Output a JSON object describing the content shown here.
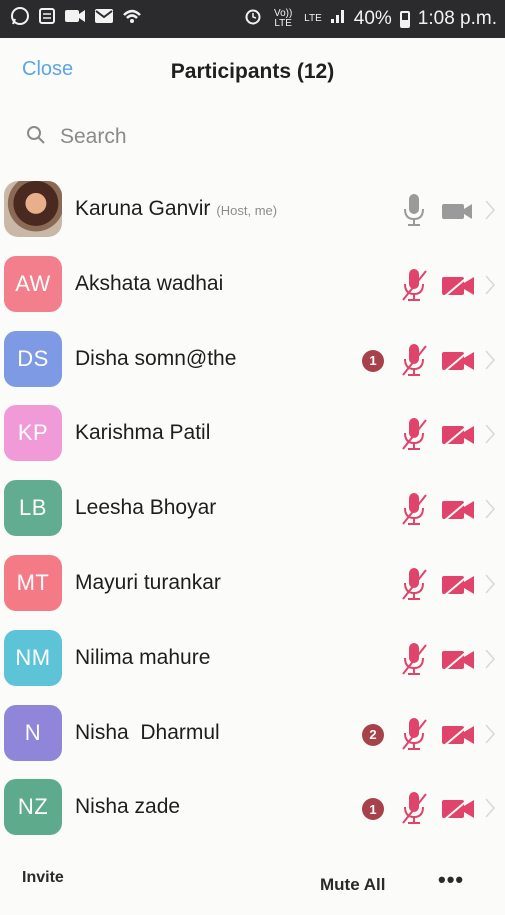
{
  "status_bar": {
    "left_icons": [
      "whatsapp-icon",
      "message-icon",
      "video-icon",
      "email-icon",
      "wifi-sync-icon"
    ],
    "alarm_icon": "alarm-icon",
    "volte_label": "Vo)) LTE",
    "lte_label": "LTE",
    "battery": "40%",
    "time": "1:08 p.m."
  },
  "header": {
    "close_label": "Close",
    "title": "Participants (12)"
  },
  "search": {
    "placeholder": "Search"
  },
  "participants": [
    {
      "initials": "",
      "name": "Karuna Ganvir",
      "tag": "(Host, me)",
      "color": "",
      "photo": true,
      "badge": "",
      "muted": false
    },
    {
      "initials": "AW",
      "name": "Akshata wadhai",
      "tag": "",
      "color": "#f37e8c",
      "photo": false,
      "badge": "",
      "muted": true
    },
    {
      "initials": "DS",
      "name": "Disha somn@the",
      "tag": "",
      "color": "#7f9ae4",
      "photo": false,
      "badge": "1",
      "muted": true
    },
    {
      "initials": "KP",
      "name": "Karishma Patil",
      "tag": "",
      "color": "#f09ad8",
      "photo": false,
      "badge": "",
      "muted": true
    },
    {
      "initials": "LB",
      "name": "Leesha Bhoyar",
      "tag": "",
      "color": "#62ad91",
      "photo": false,
      "badge": "",
      "muted": true
    },
    {
      "initials": "MT",
      "name": "Mayuri turankar",
      "tag": "",
      "color": "#f47a86",
      "photo": false,
      "badge": "",
      "muted": true
    },
    {
      "initials": "NM",
      "name": "Nilima mahure",
      "tag": "",
      "color": "#5dc3d7",
      "photo": false,
      "badge": "",
      "muted": true
    },
    {
      "initials": "N",
      "name": "Nisha  Dharmul",
      "tag": "",
      "color": "#8f86d9",
      "photo": false,
      "badge": "2",
      "muted": true
    },
    {
      "initials": "NZ",
      "name": "Nisha zade",
      "tag": "",
      "color": "#5dab8c",
      "photo": false,
      "badge": "1",
      "muted": true
    }
  ],
  "footer": {
    "invite_label": "Invite",
    "mute_all_label": "Mute All",
    "more_label": "•••"
  },
  "colors": {
    "accent": "#5aa6e8",
    "muted_icon": "#e0446b",
    "active_icon": "#9a9a9a",
    "badge": "#a8424a",
    "status_bar": "#2b2b2d"
  }
}
